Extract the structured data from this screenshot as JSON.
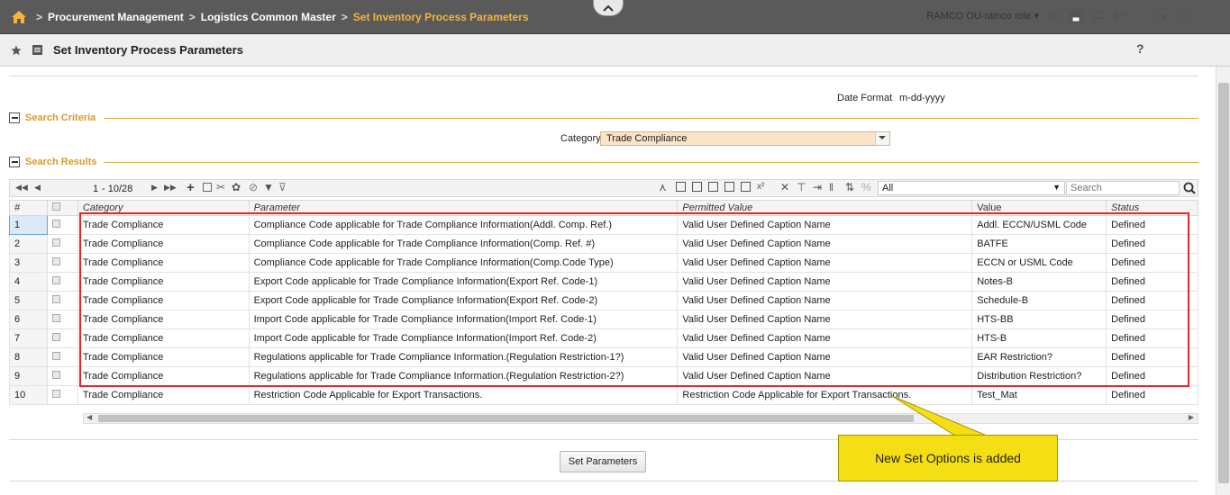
{
  "breadcrumb": {
    "items": [
      "Procurement Management",
      "Logistics Common Master"
    ],
    "current": "Set Inventory Process Parameters"
  },
  "page_title": "Set Inventory Process Parameters",
  "ou_role": "RAMCO OU-ramco role",
  "date_format": {
    "label": "Date Format",
    "value": "m-dd-yyyy"
  },
  "sections": {
    "search_criteria": "Search Criteria",
    "search_results": "Search Results"
  },
  "category_filter": {
    "label": "Category",
    "value": "Trade Compliance"
  },
  "pager": {
    "page": "1",
    "range": "- 10/28"
  },
  "toolbar": {
    "filter_value": "All",
    "search_placeholder": "Search"
  },
  "columns": [
    "#",
    "Category",
    "Parameter",
    "Permitted Value",
    "Value",
    "Status"
  ],
  "rows": [
    {
      "n": "1",
      "category": "Trade Compliance",
      "parameter": "Compliance Code applicable for Trade Compliance Information(Addl. Comp. Ref.)",
      "permitted": "Valid User Defined Caption Name",
      "value": "Addl. ECCN/USML Code",
      "status": "Defined"
    },
    {
      "n": "2",
      "category": "Trade Compliance",
      "parameter": "Compliance Code applicable for Trade Compliance Information(Comp. Ref. #)",
      "permitted": "Valid User Defined Caption Name",
      "value": "BATFE",
      "status": "Defined"
    },
    {
      "n": "3",
      "category": "Trade Compliance",
      "parameter": "Compliance Code applicable for Trade Compliance Information(Comp.Code Type)",
      "permitted": "Valid User Defined Caption Name",
      "value": "ECCN or USML Code",
      "status": "Defined"
    },
    {
      "n": "4",
      "category": "Trade Compliance",
      "parameter": "Export Code applicable for Trade Compliance Information(Export Ref. Code-1)",
      "permitted": "Valid User Defined Caption Name",
      "value": "Notes-B",
      "status": "Defined"
    },
    {
      "n": "5",
      "category": "Trade Compliance",
      "parameter": "Export Code applicable for Trade Compliance Information(Export Ref. Code-2)",
      "permitted": "Valid User Defined Caption Name",
      "value": "Schedule-B",
      "status": "Defined"
    },
    {
      "n": "6",
      "category": "Trade Compliance",
      "parameter": "Import Code applicable for Trade Compliance Information(Import Ref. Code-1)",
      "permitted": "Valid User Defined Caption Name",
      "value": "HTS-BB",
      "status": "Defined"
    },
    {
      "n": "7",
      "category": "Trade Compliance",
      "parameter": "Import Code applicable for Trade Compliance Information(Import Ref. Code-2)",
      "permitted": "Valid User Defined Caption Name",
      "value": "HTS-B",
      "status": "Defined"
    },
    {
      "n": "8",
      "category": "Trade Compliance",
      "parameter": "Regulations applicable for Trade Compliance Information.(Regulation Restriction-1?)",
      "permitted": "Valid User Defined Caption Name",
      "value": "EAR Restriction?",
      "status": "Defined"
    },
    {
      "n": "9",
      "category": "Trade Compliance",
      "parameter": "Regulations applicable for Trade Compliance Information.(Regulation Restriction-2?)",
      "permitted": "Valid User Defined Caption Name",
      "value": "Distribution Restriction?",
      "status": "Defined"
    },
    {
      "n": "10",
      "category": "Trade Compliance",
      "parameter": "Restriction Code Applicable for Export Transactions.",
      "permitted": "Restriction Code Applicable for Export Transactions.",
      "value": "Test_Mat",
      "status": "Defined"
    }
  ],
  "set_parameters_label": "Set Parameters",
  "callout": "New Set Options is added",
  "colors": {
    "accent": "#f6b43a",
    "section": "#d89a2b",
    "highlight": "#e8262a",
    "callout": "#f4df14"
  }
}
